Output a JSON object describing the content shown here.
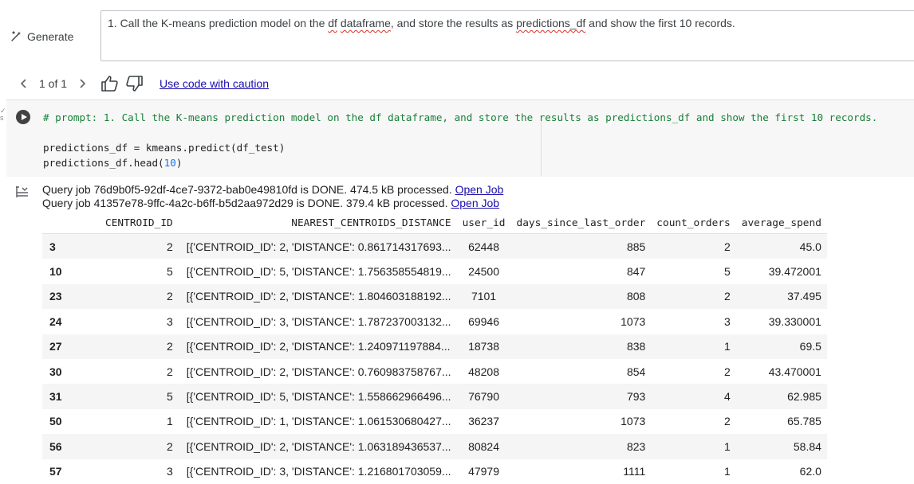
{
  "generate": {
    "button_label": "Generate",
    "prompt_before": "1. Call the K-means prediction model on the ",
    "prompt_w1": "df",
    "prompt_sp": " ",
    "prompt_w2": "dataframe",
    "prompt_mid": ", and store the results as ",
    "prompt_w3": "predictions_df",
    "prompt_after": " and show the first 10 records."
  },
  "feedback": {
    "pager": "1 of 1",
    "caution_link": "Use code with caution"
  },
  "code": {
    "comment": "# prompt: 1. Call the K-means prediction model on the df dataframe, and store the results as predictions_df and show the first 10 records.",
    "line1": "predictions_df = kmeans.predict(df_test)",
    "line2_a": "predictions_df.head(",
    "line2_num": "10",
    "line2_b": ")"
  },
  "output": {
    "job1_text": "Query job 76d9b0f5-92df-4ce7-9372-bab0e49810fd is DONE. 474.5 kB processed.",
    "job2_text": "Query job 41357e78-9ffc-4a2c-b6ff-b5d2aa972d29 is DONE. 379.4 kB processed.",
    "open_job_label": "Open Job"
  },
  "table": {
    "columns": [
      "",
      "CENTROID_ID",
      "NEAREST_CENTROIDS_DISTANCE",
      "user_id",
      "days_since_last_order",
      "count_orders",
      "average_spend"
    ],
    "rows": [
      [
        "3",
        "2",
        "[{'CENTROID_ID': 2, 'DISTANCE': 0.861714317693...",
        "62448",
        "885",
        "2",
        "45.0"
      ],
      [
        "10",
        "5",
        "[{'CENTROID_ID': 5, 'DISTANCE': 1.756358554819...",
        "24500",
        "847",
        "5",
        "39.472001"
      ],
      [
        "23",
        "2",
        "[{'CENTROID_ID': 2, 'DISTANCE': 1.804603188192...",
        "7101",
        "808",
        "2",
        "37.495"
      ],
      [
        "24",
        "3",
        "[{'CENTROID_ID': 3, 'DISTANCE': 1.787237003132...",
        "69946",
        "1073",
        "3",
        "39.330001"
      ],
      [
        "27",
        "2",
        "[{'CENTROID_ID': 2, 'DISTANCE': 1.240971197884...",
        "18738",
        "838",
        "1",
        "69.5"
      ],
      [
        "30",
        "2",
        "[{'CENTROID_ID': 2, 'DISTANCE': 0.760983758767...",
        "48208",
        "854",
        "2",
        "43.470001"
      ],
      [
        "31",
        "5",
        "[{'CENTROID_ID': 5, 'DISTANCE': 1.558662966496...",
        "76790",
        "793",
        "4",
        "62.985"
      ],
      [
        "50",
        "1",
        "[{'CENTROID_ID': 1, 'DISTANCE': 1.061530680427...",
        "36237",
        "1073",
        "2",
        "65.785"
      ],
      [
        "56",
        "2",
        "[{'CENTROID_ID': 2, 'DISTANCE': 1.063189436537...",
        "80824",
        "823",
        "1",
        "58.84"
      ],
      [
        "57",
        "3",
        "[{'CENTROID_ID': 3, 'DISTANCE': 1.216801703059...",
        "47979",
        "1111",
        "1",
        "62.0"
      ]
    ]
  }
}
